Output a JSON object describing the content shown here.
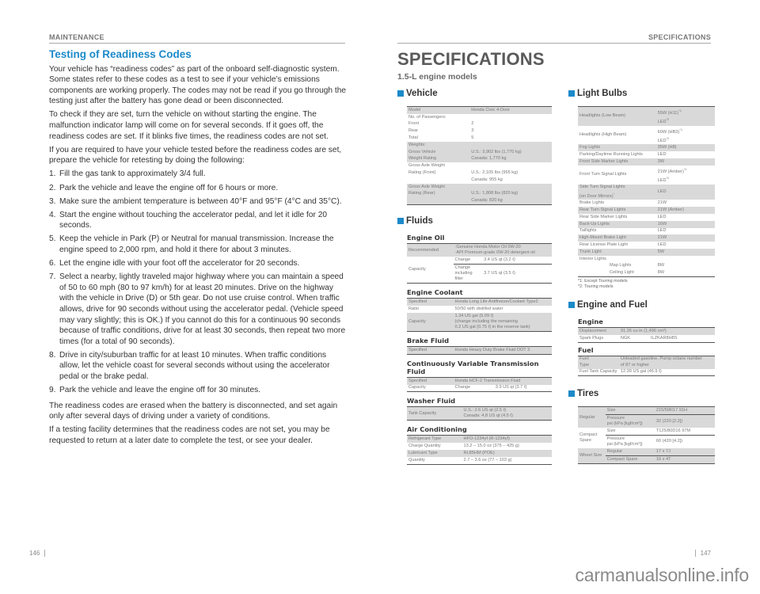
{
  "left_page": {
    "running_head": "MAINTENANCE",
    "title": "Testing of Readiness Codes",
    "paragraphs_top": [
      "Your vehicle has “readiness codes” as part of the onboard self-diagnostic system. Some states refer to these codes as a test to see if your vehicle’s emissions components are working properly. The codes may not be read if you go through the testing just after the battery has gone dead or been disconnected.",
      "To check if they are set, turn the vehicle on without starting the engine. The malfunction indicator lamp will come on for several seconds. If it goes off, the readiness codes are set. If it blinks five times, the readiness codes are not set.",
      "If you are required to have your vehicle tested before the readiness codes are set, prepare the vehicle for retesting by doing the following:"
    ],
    "steps": [
      {
        "num": "1.",
        "text": "Fill the gas tank to approximately 3/4 full."
      },
      {
        "num": "2.",
        "text": "Park the vehicle and leave the engine off for 6 hours or more."
      },
      {
        "num": "3.",
        "text": "Make sure the ambient temperature is between 40°F and 95°F (4°C and 35°C)."
      },
      {
        "num": "4.",
        "text": "Start the engine without touching the accelerator pedal, and let it idle for 20 seconds."
      },
      {
        "num": "5.",
        "text": "Keep the vehicle in Park (P) or Neutral for manual transmission. Increase the engine speed to 2,000 rpm, and hold it there for about 3 minutes."
      },
      {
        "num": "6.",
        "text": "Let the engine idle with your foot off the accelerator for 20 seconds."
      },
      {
        "num": "7.",
        "text": "Select a nearby, lightly traveled major highway where you can maintain a speed of 50 to 60 mph (80 to 97 km/h) for at least 20 minutes. Drive on the highway with the vehicle in Drive (D) or 5th gear. Do not use cruise control. When traffic allows, drive for 90 seconds without using the accelerator pedal. (Vehicle speed may vary slightly; this is OK.) If you cannot do this for a continuous 90 seconds because of traffic conditions, drive for at least 30 seconds, then repeat two more times (for a total of 90 seconds)."
      },
      {
        "num": "8.",
        "text": "Drive in city/suburban traffic for at least 10 minutes. When traffic conditions allow, let the vehicle coast for several seconds without using the accelerator pedal or the brake pedal."
      },
      {
        "num": "9.",
        "text": "Park the vehicle and leave the engine off for 30 minutes."
      }
    ],
    "paragraphs_bottom": [
      "The readiness codes are erased when the battery is disconnected, and set again only after several days of driving under a variety of conditions.",
      "If a testing facility determines that the readiness codes are not set, you may be requested to return at a later date to complete the test, or see your dealer."
    ],
    "page_number": "146"
  },
  "right_page": {
    "running_head": "SPECIFICATIONS",
    "title": "SPECIFICATIONS",
    "subtitle": "1.5-L engine models",
    "page_number": "147",
    "vehicle": {
      "heading": "Vehicle",
      "model_label": "Model",
      "model_value": "Honda Civic 4-Door",
      "passengers_label": "No. of Passengers:",
      "front_label": "Front",
      "front_value": "2",
      "rear_label": "Rear",
      "rear_value": "3",
      "total_label": "Total",
      "total_value": "5",
      "weights_label": "Weights:",
      "gvwr_label1": "Gross Vehicle",
      "gvwr_label2": "Weight Rating",
      "gvwr_us": "U.S.: 3,902 lbs (1,770 kg)",
      "gvwr_ca": "Canada: 1,770 kg",
      "gawr_f_label1": "Gross Axle Weight",
      "gawr_f_label2": "Rating (Front)",
      "gawr_f_us": "U.S.: 2,105 lbs (955 kg)",
      "gawr_f_ca": "Canada: 955 kg",
      "gawr_r_label1": "Gross Axle Weight",
      "gawr_r_label2": "Rating (Rear)",
      "gawr_r_us": "U.S.: 1,808 lbs (820 kg)",
      "gawr_r_ca": "Canada: 820 kg"
    },
    "fluids": {
      "heading": "Fluids",
      "engine_oil": {
        "heading": "Engine Oil",
        "recommended_label": "Recommended",
        "recommended_1": "·Genuine Honda Motor Oil 0W-20",
        "recommended_2": "·API Premium-grade 0W-20 detergent oil",
        "capacity_label": "Capacity",
        "change_label": "Change",
        "change_value": "3.4 US qt (3.2 ℓ)",
        "change_filter_label": "Change including filter",
        "change_filter_value": "3.7 US qt (3.5 ℓ)"
      },
      "coolant": {
        "heading": "Engine Coolant",
        "specified_label": "Specified",
        "specified_value": "Honda Long Life Antifreeze/Coolant Type2",
        "ratio_label": "Ratio",
        "ratio_value": "50/50 with distilled water",
        "capacity_label": "Capacity",
        "capacity_1": "1.34 US gal (5.09 ℓ)",
        "capacity_2": "(change including the remaining",
        "capacity_3": "0.2 US gal (0.75 ℓ) in the reserve tank)"
      },
      "brake": {
        "heading": "Brake Fluid",
        "specified_label": "Specified",
        "specified_value": "Honda Heavy Duty Brake Fluid DOT 3"
      },
      "cvt": {
        "heading": "Continuously Variable Transmission Fluid",
        "specified_label": "Specified",
        "specified_value": "Honda HCF-2 Transmission Fluid",
        "capacity_label": "Capacity",
        "change_label": "Change",
        "change_value": "3.9 US qt (3.7 ℓ)"
      },
      "washer": {
        "heading": "Washer Fluid",
        "tank_label": "Tank Capacity",
        "us_value": "U.S.: 2.6 US qt (2.5 ℓ)",
        "ca_value": "Canada: 4.8 US qt (4.5 ℓ)"
      },
      "ac": {
        "heading": "Air Conditioning",
        "rows": [
          {
            "label": "Refrigerant Type",
            "value": "HFO-1234yf (R-1234yf)"
          },
          {
            "label": "Charge Quantity",
            "value": "13.2 – 15.0 oz (375 – 425 g)"
          },
          {
            "label": "Lubricant Type",
            "value": "RL85HM (POE)"
          },
          {
            "label": "Quantity",
            "value": "2.7 – 3.6 oz (77 – 103 g)"
          }
        ]
      }
    },
    "light_bulbs": {
      "heading": "Light Bulbs",
      "headlights_low": {
        "label": "Headlights (Low Beam)",
        "v1": "55W (H11)",
        "v1_note": "*1",
        "v2": "LED",
        "v2_note": "*2"
      },
      "headlights_high": {
        "label": "Headlights (High Beam)",
        "v1": "60W (HB3)",
        "v1_note": "*1",
        "v2": "LED",
        "v2_note": "*2"
      },
      "fog": {
        "label": "Fog Lights",
        "value": "35W (H8)"
      },
      "parking": {
        "label": "Parking/Daytime Running Lights",
        "value": "LED"
      },
      "front_side_marker": {
        "label": "Front Side Marker Lights",
        "value": "3W"
      },
      "front_turn": {
        "label": "Front Turn Signal Lights",
        "v1": "21W (Amber)",
        "v1_note": "*1",
        "v2": "LED",
        "v2_note": "*2"
      },
      "side_turn": {
        "label1": "Side Turn Signal Lights",
        "label2": "(on Door Mirrors)",
        "label_note": "*",
        "value": "LED"
      },
      "brake": {
        "label": "Brake Lights",
        "value": "21W"
      },
      "rear_turn": {
        "label": "Rear Turn Signal Lights",
        "value": "21W (Amber)"
      },
      "rear_side_marker": {
        "label": "Rear Side Marker Lights",
        "value": "LED"
      },
      "back_up": {
        "label": "Back-Up Lights",
        "value": "16W"
      },
      "taillights": {
        "label": "Taillights",
        "value": "LED"
      },
      "high_mount": {
        "label": "High-Mount Brake Light",
        "value": "21W"
      },
      "license": {
        "label": "Rear License Plate Light",
        "value": "LED"
      },
      "trunk": {
        "label": "Trunk Light",
        "value": "5W"
      },
      "interior": {
        "label": "Interior Lights"
      },
      "map": {
        "label": "Map Lights",
        "value": "8W"
      },
      "ceiling": {
        "label": "Ceiling Light",
        "value": "8W"
      },
      "footnote_1": "*1:  Except Touring models",
      "footnote_2": "*2:  Touring models"
    },
    "engine_fuel": {
      "heading": "Engine and Fuel",
      "engine": {
        "heading": "Engine",
        "displacement_label": "Displacement",
        "displacement_value": "91.26 cu-in (1,496 cm³)",
        "spark_label": "Spark Plugs",
        "spark_brand": "NGK",
        "spark_value": "ILZKAR8H8S"
      },
      "fuel": {
        "heading": "Fuel",
        "type_label1": "Fuel:",
        "type_label2": "Type",
        "type_value1": "Unleaded gasoline, Pump octane number",
        "type_value2": "of 87 or higher",
        "tank_label": "Fuel Tank Capacity",
        "tank_value": "12.39 US gal (46.9 ℓ)"
      }
    },
    "tires": {
      "heading": "Tires",
      "regular_label": "Regular",
      "regular_size_label": "Size",
      "regular_size_value": "215/50R17 91H",
      "regular_pressure_label1": "Pressure",
      "regular_pressure_label2": "psi (kPa [kgf/cm²])",
      "regular_pressure_value": "32 (220 [2.2])",
      "spare_label1": "Compact",
      "spare_label2": "Spare",
      "spare_size_label": "Size",
      "spare_size_value": "T125/80D16 97M",
      "spare_pressure_label1": "Pressure",
      "spare_pressure_label2": "psi (kPa [kgf/cm²])",
      "spare_pressure_value": "60 (420 [4.2])",
      "wheel_label": "Wheel Size",
      "wheel_regular_label": "Regular",
      "wheel_regular_value": "17 x 7J",
      "wheel_spare_label": "Compact Spare",
      "wheel_spare_value": "16 x 4T"
    }
  },
  "watermark": "carmanualsonline.info"
}
